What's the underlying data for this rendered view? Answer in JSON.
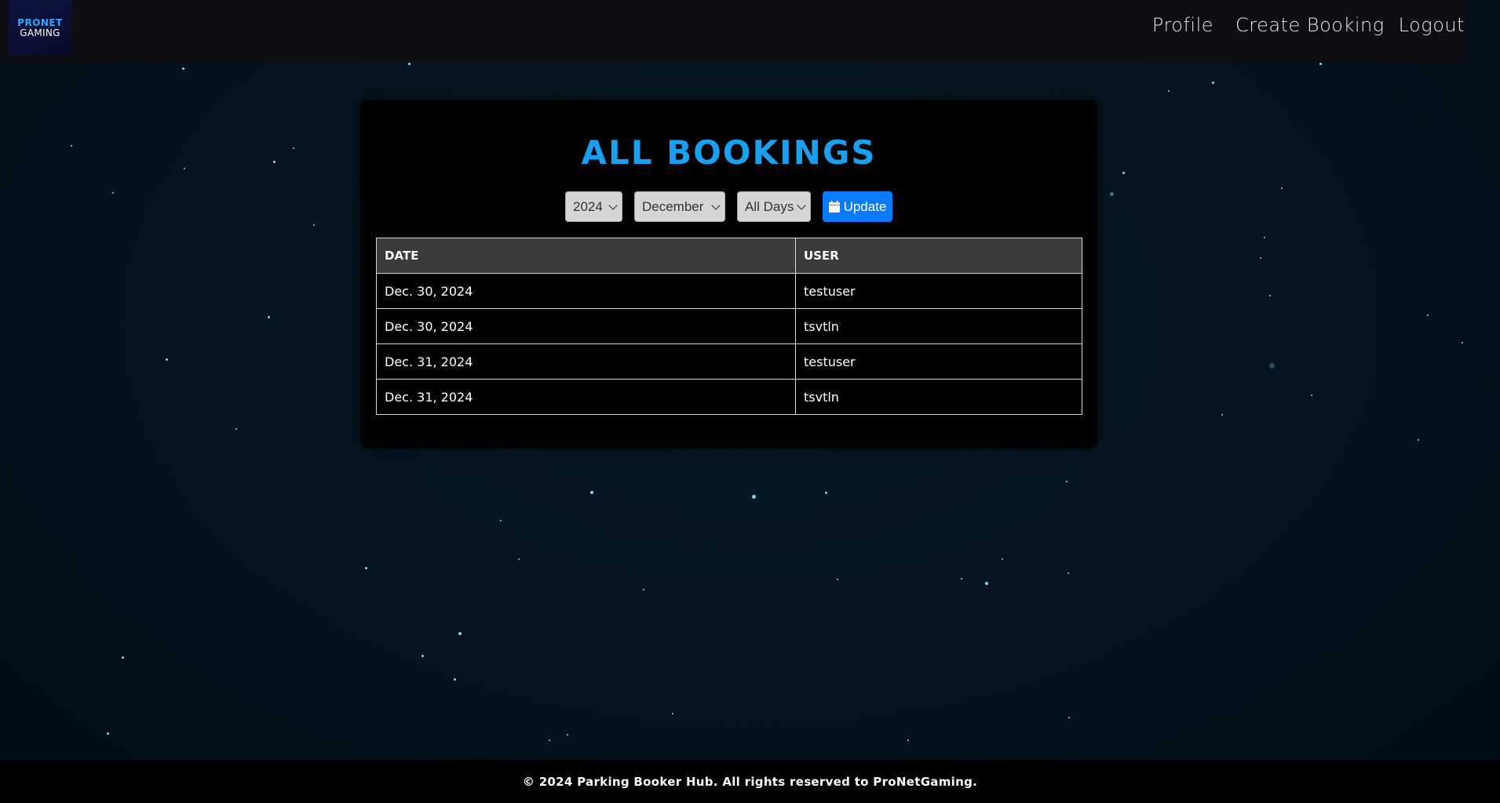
{
  "brand": {
    "logo_line1": "PRONET",
    "logo_line2": "GAMING"
  },
  "nav": {
    "profile": "Profile",
    "create_booking": "Create Booking",
    "logout": "Logout"
  },
  "page": {
    "title": "ALL BOOKINGS"
  },
  "filters": {
    "year": "2024",
    "month": "December",
    "days": "All Days",
    "update_label": "Update",
    "update_icon": "calendar-icon"
  },
  "table": {
    "headers": [
      "DATE",
      "USER"
    ],
    "rows": [
      {
        "date": "Dec. 30, 2024",
        "user": "testuser"
      },
      {
        "date": "Dec. 30, 2024",
        "user": "tsvtln"
      },
      {
        "date": "Dec. 31, 2024",
        "user": "testuser"
      },
      {
        "date": "Dec. 31, 2024",
        "user": "tsvtln"
      }
    ]
  },
  "footer": {
    "text": "© 2024 Parking Booker Hub. All rights reserved to ProNetGaming."
  },
  "colors": {
    "accent": "#1aa0f0",
    "button": "#0a7bff",
    "background": "#041420"
  }
}
